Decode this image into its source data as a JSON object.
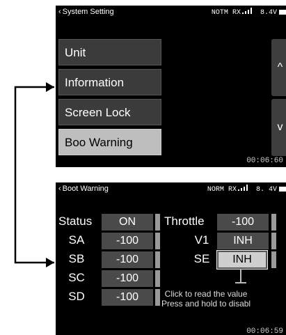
{
  "screen1": {
    "title": "System Setting",
    "status_mode": "NOTM",
    "status_rx": "RX",
    "voltage": "8.4V",
    "menu_items": [
      "Unit",
      "Information",
      "Screen Lock",
      "Boo Warning"
    ],
    "selected_index": 3,
    "scroll_up_icon": "chevron-up-icon",
    "scroll_down_icon": "chevron-down-icon",
    "scroll_up": "^",
    "scroll_down": "v",
    "timer": "00:06:60"
  },
  "screen2": {
    "title": "Boot Warning",
    "status_mode": "NORM",
    "status_rx": "RX",
    "voltage": "8. 4V",
    "left_rows": [
      {
        "label": "Status",
        "value": "ON"
      },
      {
        "label": "SA",
        "value": "-100"
      },
      {
        "label": "SB",
        "value": "-100"
      },
      {
        "label": "SC",
        "value": "-100"
      },
      {
        "label": "SD",
        "value": "-100"
      }
    ],
    "right_rows": [
      {
        "label": "Throttle",
        "value": "-100"
      },
      {
        "label": "V1",
        "value": "INH"
      },
      {
        "label": "SE",
        "value": "INH"
      }
    ],
    "hint_line1": "Click to read the value",
    "hint_line2": "Press and hold to disabl",
    "timer": "00:06:59"
  },
  "colors": {
    "menu_bg": "#3b3b3b",
    "menu_selected_bg": "#bebebe",
    "value_bg": "#4a4a4a",
    "arrow": "#000000"
  }
}
